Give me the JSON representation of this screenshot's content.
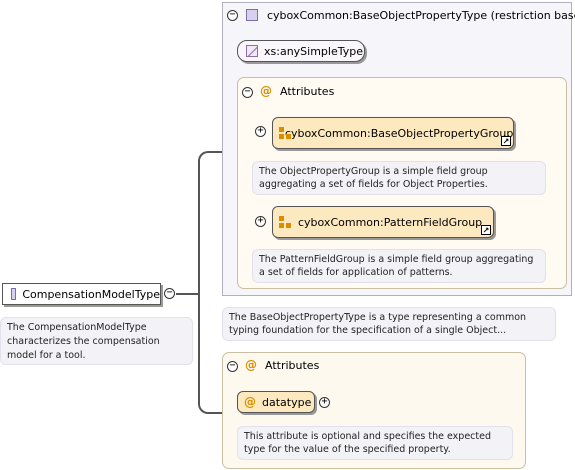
{
  "root_element": {
    "name": "CompensationModelType",
    "doc": "The CompensationModelType characterizes the compensation model for a tool."
  },
  "restriction": {
    "title": "cyboxCommon:BaseObjectPropertyType (restriction base)",
    "base_simple_type": "xs:anySimpleType",
    "attributes_label": "Attributes",
    "groups": [
      {
        "name": "cyboxCommon:BaseObjectPropertyGroup",
        "doc": "The ObjectPropertyGroup is a simple field group aggregating a set of fields for Object Properties."
      },
      {
        "name": "cyboxCommon:PatternFieldGroup",
        "doc": "The PatternFieldGroup is a simple field group aggregating a set of fields for application of patterns."
      }
    ],
    "doc": "The BaseObjectPropertyType is a type representing a common typing foundation for the specification of a single Object..."
  },
  "attributes": {
    "label": "Attributes",
    "items": [
      {
        "name": "datatype",
        "doc": "This attribute is optional and specifies the expected type for the value of the specified property."
      }
    ]
  },
  "icons": {
    "collapse": "minus-circle-icon",
    "expand": "plus-circle-icon",
    "attribute": "at-sign-icon",
    "group": "attribute-group-icon",
    "type": "complex-type-icon",
    "simple_type": "simple-type-icon",
    "link": "link-arrow-icon"
  },
  "colors": {
    "connector": "#555555",
    "attribute_fill": "#fde9c0",
    "attribute_panel": "#fdf9ef",
    "type_icon": "#d8d0ee",
    "accent": "#d98e00"
  }
}
